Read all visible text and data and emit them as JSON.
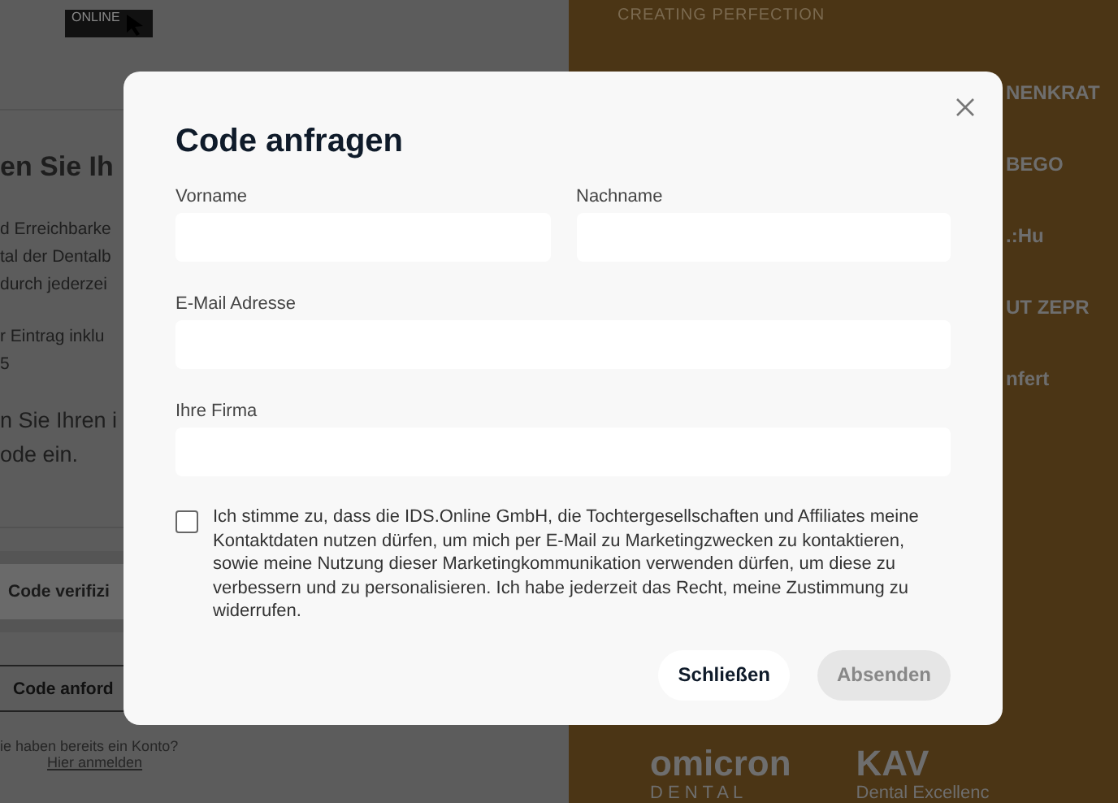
{
  "background": {
    "logo": "ONLINE",
    "heading": "en Sie Ih",
    "paragraph_lines": [
      "d Erreichbarke",
      "tal der Dentalb",
      "durch jederzei"
    ],
    "entry_lines": [
      "r Eintrag inklu",
      "5"
    ],
    "prompt_lines": [
      "n Sie Ihren i",
      "ode ein."
    ],
    "verify_button": {
      "label": "Code verifizi"
    },
    "request_button": {
      "label": "Code anford"
    },
    "account_question": "ie haben bereits ein Konto?",
    "login_link": "Hier anmelden",
    "tagline": "CREATING PERFECTION",
    "side_logos": [
      "NENKRAT",
      "BEGO",
      ".:Hu",
      "UT ZEPR",
      "nfert"
    ],
    "bottom_logos": [
      {
        "name": "omicron",
        "sub": "D E N T A L"
      },
      {
        "name": "KAV",
        "sub": "Dental Excellenc"
      }
    ]
  },
  "dialog": {
    "title": "Code anfragen",
    "fields": [
      {
        "label": "Vorname",
        "kind": "half"
      },
      {
        "label": "Nachname",
        "kind": "half"
      },
      {
        "label": "E-Mail Adresse",
        "kind": "full"
      },
      {
        "label": "Ihre Firma",
        "kind": "full"
      }
    ],
    "consent": {
      "text": "Ich stimme zu, dass die IDS.Online GmbH, die Tochtergesellschaften und Affiliates meine Kontaktdaten nutzen dürfen, um mich per E-Mail zu Marketingzwecken zu kontaktieren, sowie meine Nutzung dieser Marketingkommunikation verwenden dürfen, um diese zu verbessern und zu personalisieren. Ich habe jederzeit das Recht, meine Zustimmung zu widerrufen.",
      "checked": false
    },
    "buttons": [
      {
        "label": "Schließen",
        "kind": "secondary",
        "disabled": false
      },
      {
        "label": "Absenden",
        "kind": "primary",
        "disabled": true
      }
    ]
  }
}
